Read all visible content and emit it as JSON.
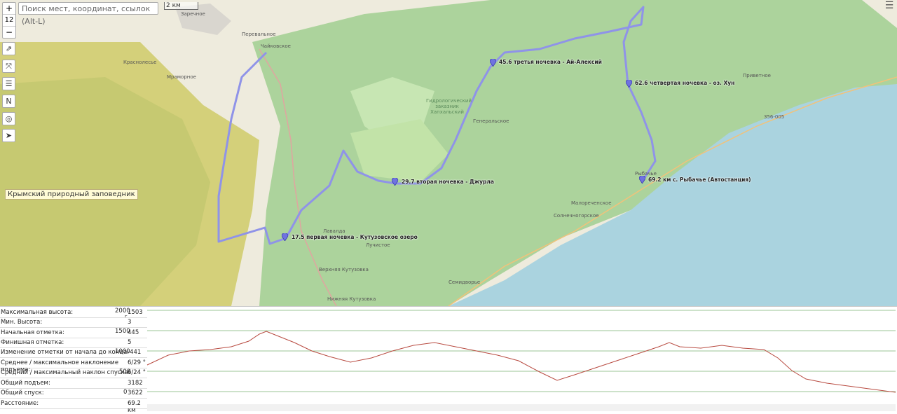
{
  "search": {
    "placeholder": "Поиск мест, координат, ссылок (Alt-L)"
  },
  "zoom": {
    "plus": "+",
    "level": "12",
    "minus": "−"
  },
  "scale": {
    "label": "2 км"
  },
  "tools": [
    "⇗",
    "⤧",
    "☰",
    "N",
    "◎",
    "➤"
  ],
  "layers_icon": "layers-icon",
  "reserve_label": "Крымский природный заповедник",
  "places": [
    {
      "name": "Заречное"
    },
    {
      "name": "Перевальное"
    },
    {
      "name": "Чайковское"
    },
    {
      "name": "Краснолесье"
    },
    {
      "name": "Мраморное"
    },
    {
      "name": "Генеральское"
    },
    {
      "name": "Приветное"
    },
    {
      "name": "356-005"
    },
    {
      "name": "Рыбачье"
    },
    {
      "name": "Малореченское"
    },
    {
      "name": "Солнечногорское"
    },
    {
      "name": "Лавалда"
    },
    {
      "name": "Лучистое"
    },
    {
      "name": "Верхняя Кутузовка"
    },
    {
      "name": "Семидворье"
    },
    {
      "name": "Нижняя Кутузовка"
    },
    {
      "name": "Гидрологический заказник Хапхальский"
    }
  ],
  "waypoints": [
    {
      "label": "17.5 первая ночевка - Кутузовское озеро"
    },
    {
      "label": "29.7 вторая ночевка - Джурла"
    },
    {
      "label": "45.6 третья ночевка - Ай-Алексий"
    },
    {
      "label": "62.6 четвертая ночевка - оз. Хун"
    },
    {
      "label": "69.2 км с. Рыбачье (Автостанция)"
    }
  ],
  "stats": [
    {
      "label": "Максимальная высота:",
      "value": "1503"
    },
    {
      "label": "Мин. Высота:",
      "value": "3"
    },
    {
      "label": "Начальная отметка:",
      "value": "445"
    },
    {
      "label": "Финишная отметка:",
      "value": "5"
    },
    {
      "label": "Изменение отметки от начала до конца:",
      "value": "-441"
    },
    {
      "label": "Среднее / максимальное наклонение подъема:",
      "value": "6/29 °"
    },
    {
      "label": "Средний / максимальный наклон спуска:",
      "value": "6/24 °"
    },
    {
      "label": "Общий подъем:",
      "value": "3182"
    },
    {
      "label": "Общий спуск:",
      "value": "3622"
    },
    {
      "label": "Расстояние:",
      "value": "69.2 км"
    }
  ],
  "profile_axis": {
    "ticks": [
      "2000",
      "1500",
      "1000",
      "500",
      "0"
    ],
    "unit": "г."
  },
  "colors": {
    "route": "#8f93e8",
    "forest": "#a8d49a",
    "sea": "#aad3df",
    "reserve": "#d6d27a",
    "profile": "#b84a40"
  }
}
